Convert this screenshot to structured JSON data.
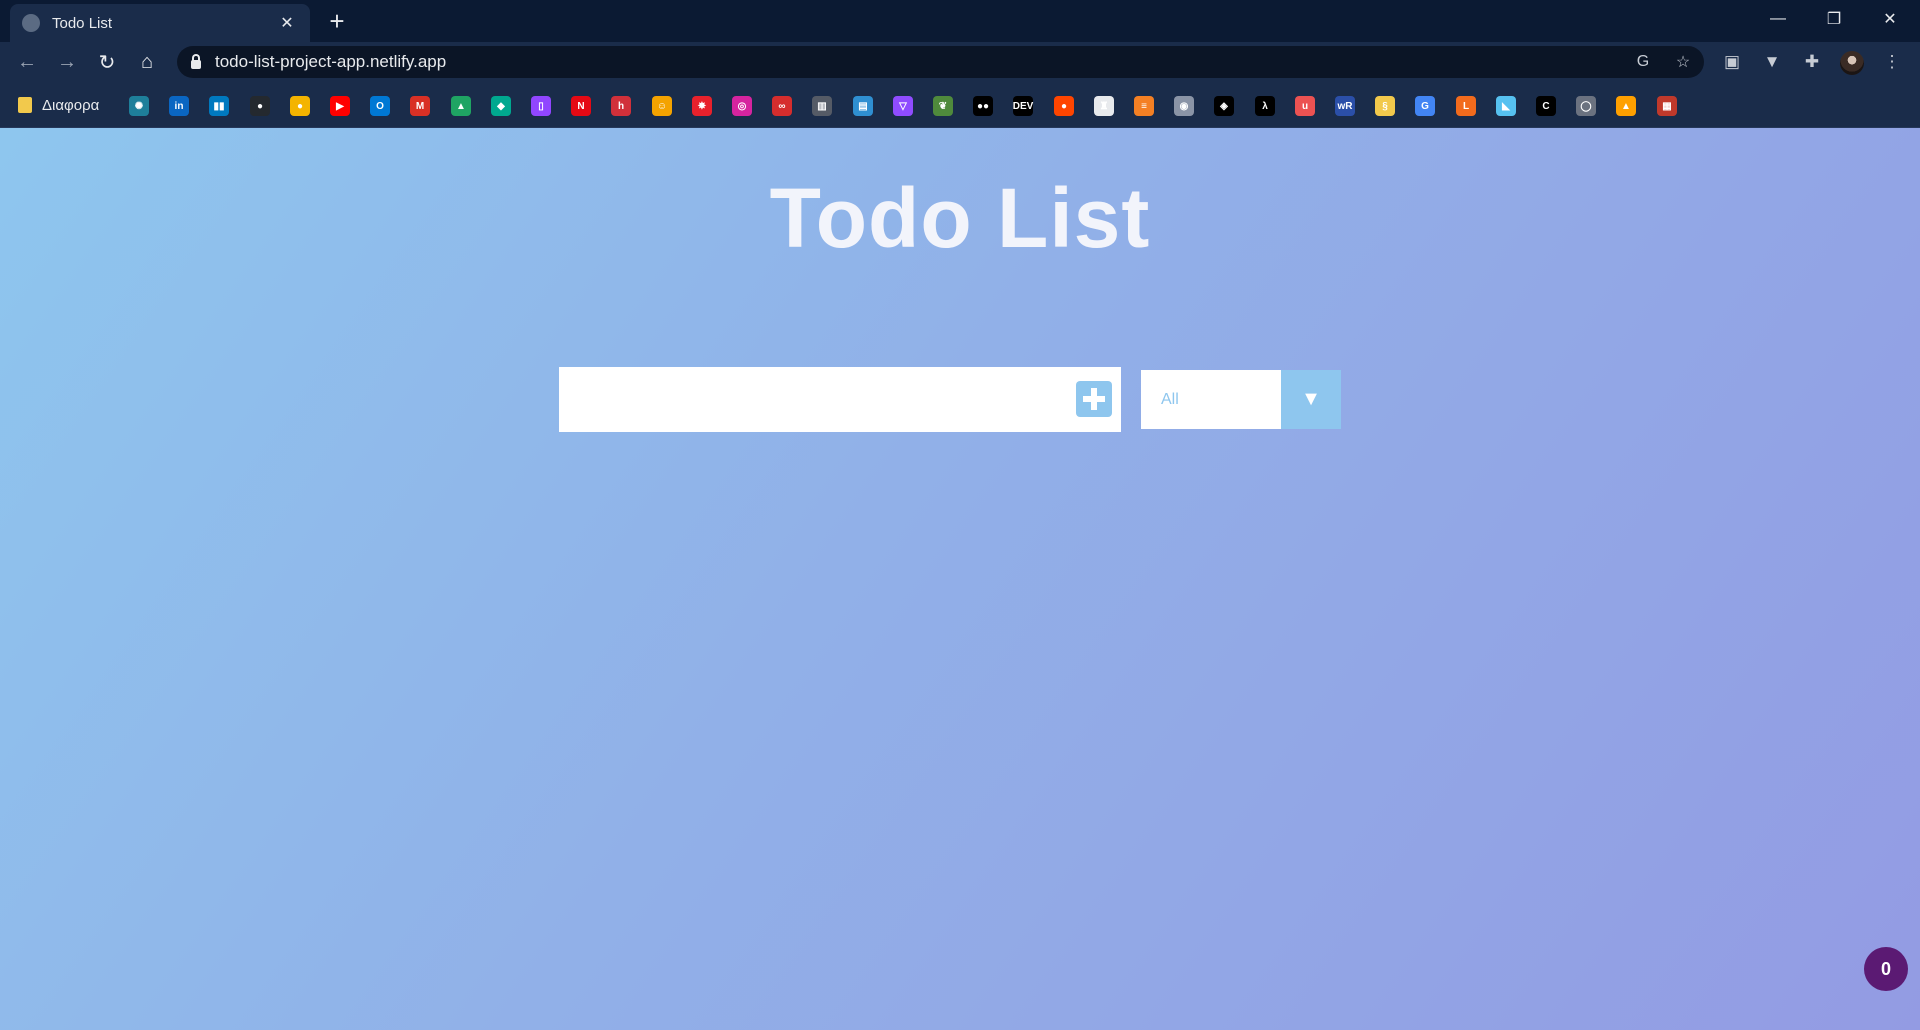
{
  "browser": {
    "tab": {
      "title": "Todo List",
      "close_glyph": "✕"
    },
    "new_tab_glyph": "+",
    "window_controls": {
      "minimize": "—",
      "restore": "❐",
      "close": "✕"
    },
    "toolbar": {
      "back_glyph": "←",
      "forward_glyph": "→",
      "reload_glyph": "↻",
      "home_glyph": "⌂",
      "url": "todo-list-project-app.netlify.app",
      "translate_glyph": "G",
      "bookmark_star_glyph": "☆",
      "extensions": [
        {
          "icon": "reading-list-icon",
          "glyph": "▣"
        },
        {
          "icon": "vue-devtools-icon",
          "glyph": "▼"
        },
        {
          "icon": "puzzle-icon",
          "glyph": "✚"
        }
      ],
      "menu_glyph": "⋮"
    },
    "bookmarks": {
      "folder_label": "Διαφορα",
      "items": [
        {
          "icon": "openai-icon",
          "glyph": "✺",
          "color": "#1e7f9a"
        },
        {
          "icon": "linkedin-icon",
          "glyph": "in",
          "color": "#0a66c2"
        },
        {
          "icon": "trello-icon",
          "glyph": "▮▮",
          "color": "#0079bf"
        },
        {
          "icon": "github-icon",
          "glyph": "●",
          "color": "#24292f"
        },
        {
          "icon": "keep-icon",
          "glyph": "●",
          "color": "#f4b400"
        },
        {
          "icon": "youtube-icon",
          "glyph": "▶",
          "color": "#ff0000"
        },
        {
          "icon": "outlook-icon",
          "glyph": "O",
          "color": "#0078d4"
        },
        {
          "icon": "gmail-icon",
          "glyph": "M",
          "color": "#d93025"
        },
        {
          "icon": "drive-icon",
          "glyph": "▲",
          "color": "#1fa463"
        },
        {
          "icon": "diamond-icon",
          "glyph": "◆",
          "color": "#00a88f"
        },
        {
          "icon": "twitch-icon",
          "glyph": "▯",
          "color": "#9146ff"
        },
        {
          "icon": "netflix-icon",
          "glyph": "N",
          "color": "#e50914"
        },
        {
          "icon": "hackerrank-icon",
          "glyph": "h",
          "color": "#d1303a"
        },
        {
          "icon": "emoji-icon",
          "glyph": "☺",
          "color": "#f4a300"
        },
        {
          "icon": "star-app-icon",
          "glyph": "✸",
          "color": "#e8212c"
        },
        {
          "icon": "instagram-icon",
          "glyph": "◎",
          "color": "#d6249f"
        },
        {
          "icon": "glasses-icon",
          "glyph": "∞",
          "color": "#d62d2d"
        },
        {
          "icon": "trash-icon",
          "glyph": "▥",
          "color": "#555b66"
        },
        {
          "icon": "calendar-icon",
          "glyph": "▤",
          "color": "#2f8fd1"
        },
        {
          "icon": "vite-icon",
          "glyph": "▽",
          "color": "#8f4cff"
        },
        {
          "icon": "leaf-icon",
          "glyph": "❦",
          "color": "#4f8a3c"
        },
        {
          "icon": "medium-icon",
          "glyph": "●●",
          "color": "#000000"
        },
        {
          "icon": "dev-icon",
          "glyph": "DEV",
          "color": "#000000"
        },
        {
          "icon": "reddit-icon",
          "glyph": "●",
          "color": "#ff4500"
        },
        {
          "icon": "hat-icon",
          "glyph": "♜",
          "color": "#e8eaed"
        },
        {
          "icon": "stackoverflow-icon",
          "glyph": "≡",
          "color": "#f48024"
        },
        {
          "icon": "circle-app-icon",
          "glyph": "◉",
          "color": "#8a94a6"
        },
        {
          "icon": "codepen-icon",
          "glyph": "◈",
          "color": "#000000"
        },
        {
          "icon": "lambda-icon",
          "glyph": "λ",
          "color": "#000000"
        },
        {
          "icon": "udemy-icon",
          "glyph": "u",
          "color": "#ec5252"
        },
        {
          "icon": "wr-icon",
          "glyph": "wR",
          "color": "#2b4fa8"
        },
        {
          "icon": "python-icon",
          "glyph": "§",
          "color": "#f2c94c"
        },
        {
          "icon": "google-translate-icon",
          "glyph": "G",
          "color": "#4285f4"
        },
        {
          "icon": "l-icon",
          "glyph": "L",
          "color": "#f26b1d"
        },
        {
          "icon": "dino-icon",
          "glyph": "◣",
          "color": "#56c1f0"
        },
        {
          "icon": "c-icon",
          "glyph": "C",
          "color": "#000000"
        },
        {
          "icon": "bulb-icon",
          "glyph": "◯",
          "color": "#6b7280"
        },
        {
          "icon": "firebase-icon",
          "glyph": "▲",
          "color": "#ffa000"
        },
        {
          "icon": "cinema-icon",
          "glyph": "▦",
          "color": "#c0392b"
        }
      ]
    }
  },
  "app": {
    "title": "Todo List",
    "todo_input": {
      "value": "",
      "placeholder": ""
    },
    "add_button_icon": "plus-icon",
    "filter": {
      "selected": "All",
      "toggle_glyph": "▼"
    },
    "counter": "0"
  },
  "colors": {
    "accent": "#8ec6ee",
    "gradient_start": "#8ec6ee",
    "gradient_end": "#939be3",
    "badge": "#5b1a73"
  }
}
